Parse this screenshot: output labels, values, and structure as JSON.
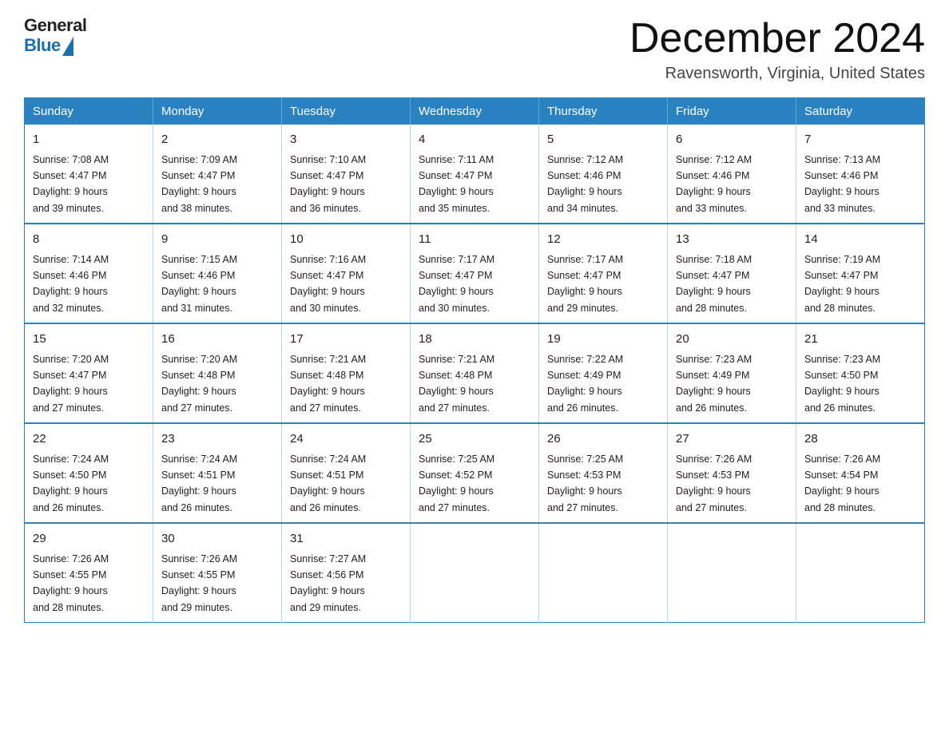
{
  "logo": {
    "general": "General",
    "blue": "Blue"
  },
  "header": {
    "month": "December 2024",
    "location": "Ravensworth, Virginia, United States"
  },
  "days_of_week": [
    "Sunday",
    "Monday",
    "Tuesday",
    "Wednesday",
    "Thursday",
    "Friday",
    "Saturday"
  ],
  "weeks": [
    [
      {
        "day": "1",
        "sunrise": "7:08 AM",
        "sunset": "4:47 PM",
        "daylight": "9 hours and 39 minutes."
      },
      {
        "day": "2",
        "sunrise": "7:09 AM",
        "sunset": "4:47 PM",
        "daylight": "9 hours and 38 minutes."
      },
      {
        "day": "3",
        "sunrise": "7:10 AM",
        "sunset": "4:47 PM",
        "daylight": "9 hours and 36 minutes."
      },
      {
        "day": "4",
        "sunrise": "7:11 AM",
        "sunset": "4:47 PM",
        "daylight": "9 hours and 35 minutes."
      },
      {
        "day": "5",
        "sunrise": "7:12 AM",
        "sunset": "4:46 PM",
        "daylight": "9 hours and 34 minutes."
      },
      {
        "day": "6",
        "sunrise": "7:12 AM",
        "sunset": "4:46 PM",
        "daylight": "9 hours and 33 minutes."
      },
      {
        "day": "7",
        "sunrise": "7:13 AM",
        "sunset": "4:46 PM",
        "daylight": "9 hours and 33 minutes."
      }
    ],
    [
      {
        "day": "8",
        "sunrise": "7:14 AM",
        "sunset": "4:46 PM",
        "daylight": "9 hours and 32 minutes."
      },
      {
        "day": "9",
        "sunrise": "7:15 AM",
        "sunset": "4:46 PM",
        "daylight": "9 hours and 31 minutes."
      },
      {
        "day": "10",
        "sunrise": "7:16 AM",
        "sunset": "4:47 PM",
        "daylight": "9 hours and 30 minutes."
      },
      {
        "day": "11",
        "sunrise": "7:17 AM",
        "sunset": "4:47 PM",
        "daylight": "9 hours and 30 minutes."
      },
      {
        "day": "12",
        "sunrise": "7:17 AM",
        "sunset": "4:47 PM",
        "daylight": "9 hours and 29 minutes."
      },
      {
        "day": "13",
        "sunrise": "7:18 AM",
        "sunset": "4:47 PM",
        "daylight": "9 hours and 28 minutes."
      },
      {
        "day": "14",
        "sunrise": "7:19 AM",
        "sunset": "4:47 PM",
        "daylight": "9 hours and 28 minutes."
      }
    ],
    [
      {
        "day": "15",
        "sunrise": "7:20 AM",
        "sunset": "4:47 PM",
        "daylight": "9 hours and 27 minutes."
      },
      {
        "day": "16",
        "sunrise": "7:20 AM",
        "sunset": "4:48 PM",
        "daylight": "9 hours and 27 minutes."
      },
      {
        "day": "17",
        "sunrise": "7:21 AM",
        "sunset": "4:48 PM",
        "daylight": "9 hours and 27 minutes."
      },
      {
        "day": "18",
        "sunrise": "7:21 AM",
        "sunset": "4:48 PM",
        "daylight": "9 hours and 27 minutes."
      },
      {
        "day": "19",
        "sunrise": "7:22 AM",
        "sunset": "4:49 PM",
        "daylight": "9 hours and 26 minutes."
      },
      {
        "day": "20",
        "sunrise": "7:23 AM",
        "sunset": "4:49 PM",
        "daylight": "9 hours and 26 minutes."
      },
      {
        "day": "21",
        "sunrise": "7:23 AM",
        "sunset": "4:50 PM",
        "daylight": "9 hours and 26 minutes."
      }
    ],
    [
      {
        "day": "22",
        "sunrise": "7:24 AM",
        "sunset": "4:50 PM",
        "daylight": "9 hours and 26 minutes."
      },
      {
        "day": "23",
        "sunrise": "7:24 AM",
        "sunset": "4:51 PM",
        "daylight": "9 hours and 26 minutes."
      },
      {
        "day": "24",
        "sunrise": "7:24 AM",
        "sunset": "4:51 PM",
        "daylight": "9 hours and 26 minutes."
      },
      {
        "day": "25",
        "sunrise": "7:25 AM",
        "sunset": "4:52 PM",
        "daylight": "9 hours and 27 minutes."
      },
      {
        "day": "26",
        "sunrise": "7:25 AM",
        "sunset": "4:53 PM",
        "daylight": "9 hours and 27 minutes."
      },
      {
        "day": "27",
        "sunrise": "7:26 AM",
        "sunset": "4:53 PM",
        "daylight": "9 hours and 27 minutes."
      },
      {
        "day": "28",
        "sunrise": "7:26 AM",
        "sunset": "4:54 PM",
        "daylight": "9 hours and 28 minutes."
      }
    ],
    [
      {
        "day": "29",
        "sunrise": "7:26 AM",
        "sunset": "4:55 PM",
        "daylight": "9 hours and 28 minutes."
      },
      {
        "day": "30",
        "sunrise": "7:26 AM",
        "sunset": "4:55 PM",
        "daylight": "9 hours and 29 minutes."
      },
      {
        "day": "31",
        "sunrise": "7:27 AM",
        "sunset": "4:56 PM",
        "daylight": "9 hours and 29 minutes."
      },
      null,
      null,
      null,
      null
    ]
  ],
  "labels": {
    "sunrise": "Sunrise:",
    "sunset": "Sunset:",
    "daylight": "Daylight:"
  }
}
